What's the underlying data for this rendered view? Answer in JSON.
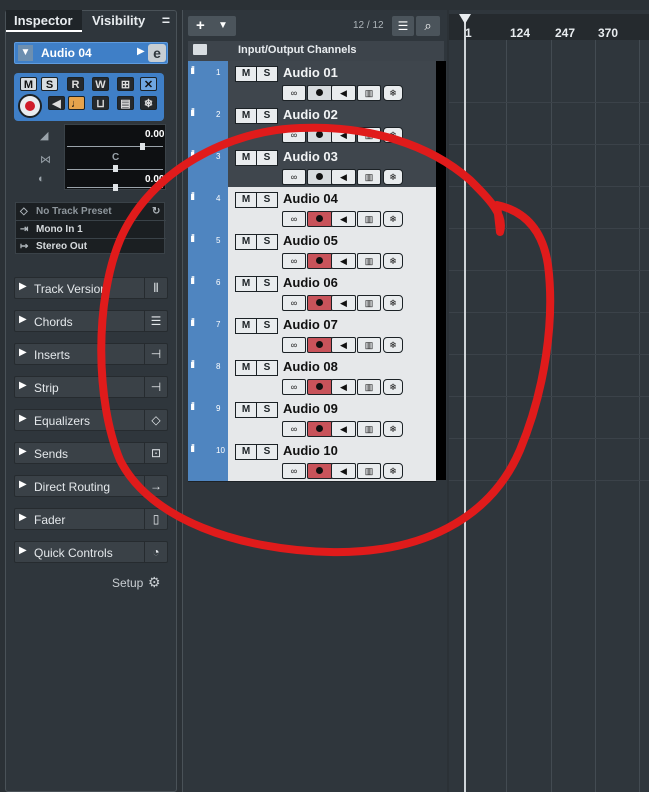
{
  "inspector": {
    "tab_inspector": "Inspector",
    "tab_visibility": "Visibility",
    "menu_icon": "=",
    "track_name": "Audio 04",
    "edit_icon": "e",
    "buttons_row1": [
      "M",
      "S",
      "R",
      "W"
    ],
    "fader": {
      "volume_value": "0.00",
      "pan_value": "C",
      "delay_value": "0.00"
    },
    "routing": {
      "preset": "No Track Preset",
      "input": "Mono In 1",
      "output": "Stereo Out"
    },
    "sections": [
      {
        "label": "Track Version",
        "icon": "versions-icon"
      },
      {
        "label": "Chords",
        "icon": "sliders-icon"
      },
      {
        "label": "Inserts",
        "icon": "insert-icon"
      },
      {
        "label": "Strip",
        "icon": "insert-icon"
      },
      {
        "label": "Equalizers",
        "icon": "eq-icon"
      },
      {
        "label": "Sends",
        "icon": "sends-icon"
      },
      {
        "label": "Direct Routing",
        "icon": "routing-icon"
      },
      {
        "label": "Fader",
        "icon": "fader-icon"
      },
      {
        "label": "Quick Controls",
        "icon": "knob-icon"
      }
    ],
    "setup_label": "Setup"
  },
  "tracklist": {
    "add_label": "+",
    "track_count": "12 / 12",
    "folder_name": "Input/Output Channels",
    "tracks": [
      {
        "num": "1",
        "name": "Audio 01",
        "selected": false
      },
      {
        "num": "2",
        "name": "Audio 02",
        "selected": false
      },
      {
        "num": "3",
        "name": "Audio 03",
        "selected": false
      },
      {
        "num": "4",
        "name": "Audio 04",
        "selected": true
      },
      {
        "num": "5",
        "name": "Audio 05",
        "selected": true
      },
      {
        "num": "6",
        "name": "Audio 06",
        "selected": true
      },
      {
        "num": "7",
        "name": "Audio 07",
        "selected": true
      },
      {
        "num": "8",
        "name": "Audio 08",
        "selected": true
      },
      {
        "num": "9",
        "name": "Audio 09",
        "selected": true
      },
      {
        "num": "10",
        "name": "Audio 10",
        "selected": true
      }
    ],
    "mute_label": "M",
    "solo_label": "S"
  },
  "ruler": {
    "labels": [
      "1",
      "124",
      "247",
      "370"
    ]
  },
  "colors": {
    "selection_blue": "#4f85c0",
    "record_red": "#c8535a",
    "annotation_red": "#e01b1b"
  }
}
